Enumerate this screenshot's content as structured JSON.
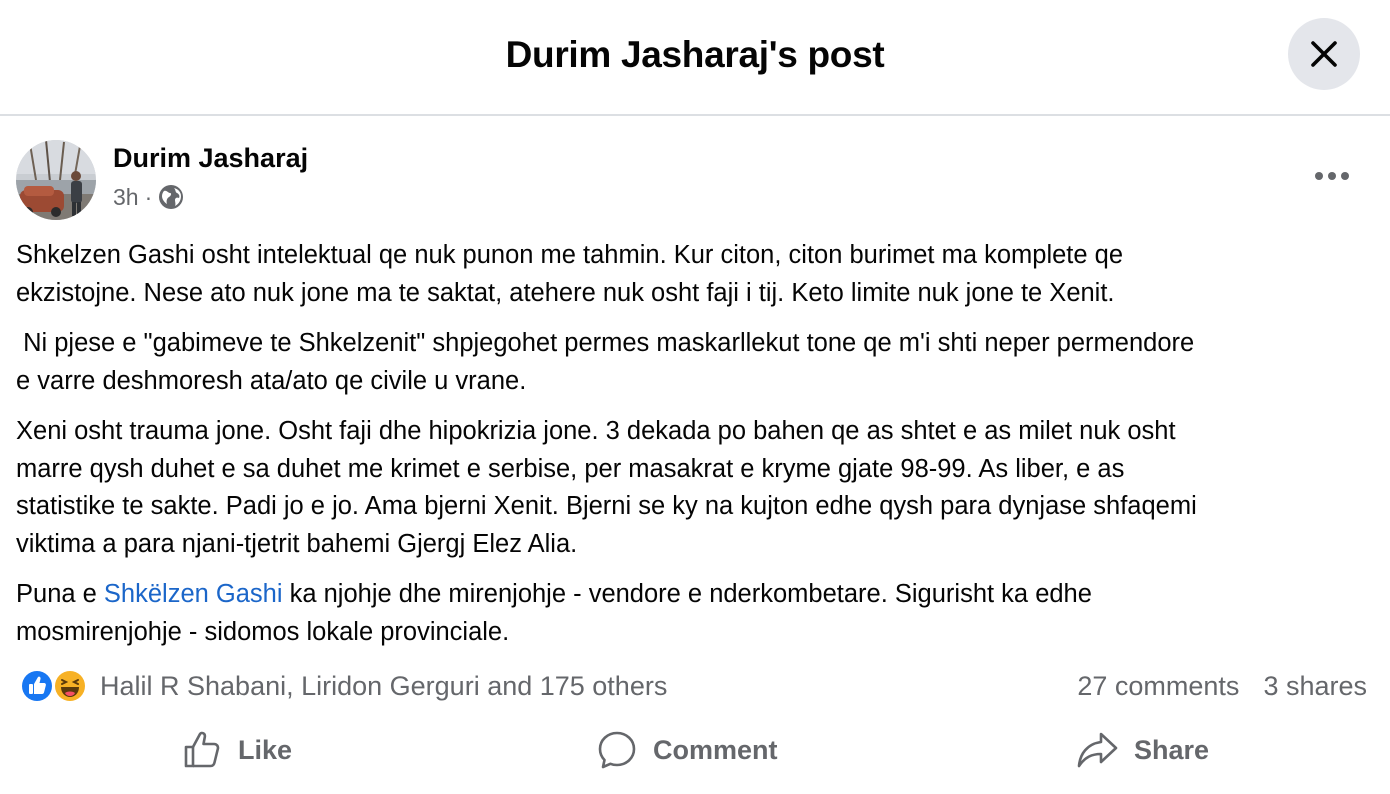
{
  "header": {
    "title": "Durim Jasharaj's post",
    "close_icon": "close-icon"
  },
  "post": {
    "author": "Durim Jasharaj",
    "time": "3h",
    "separator": "·",
    "audience_icon": "globe-icon",
    "more_icon": "more-icon",
    "paragraphs": [
      [
        "Shkelzen Gashi osht intelektual qe nuk punon me tahmin. Kur citon, citon burimet ma komplete qe",
        "ekzistojne. Nese ato nuk jone ma te saktat, atehere nuk osht faji i tij. Keto limite nuk jone te Xenit."
      ],
      [
        " Ni pjese e \"gabimeve te Shkelzenit\" shpjegohet permes maskarllekut tone qe m'i shti neper permendore",
        "e varre deshmoresh ata/ato qe civile u vrane."
      ],
      [
        "Xeni osht trauma jone. Osht faji dhe hipokrizia jone. 3 dekada po bahen qe as shtet e as milet nuk osht",
        "marre qysh duhet e sa duhet me krimet e serbise, per masakrat e kryme gjate 98-99. As liber, e as",
        "statistike te sakte. Padi jo e jo. Ama bjerni Xenit. Bjerni se ky na kujton edhe qysh para dynjase shfaqemi",
        "viktima a para njani-tjetrit bahemi Gjergj Elez Alia."
      ]
    ],
    "last_paragraph": {
      "prefix": "Puna e ",
      "mention": "Shkëlzen Gashi",
      "suffix": " ka njohje dhe mirenjohje - vendore e nderkombetare. Sigurisht ka edhe",
      "line2": "mosmirenjohje - sidomos lokale provinciale."
    }
  },
  "reactions": {
    "icons": [
      "like-reaction-icon",
      "haha-reaction-icon"
    ],
    "summary": "Halil R Shabani, Liridon Gerguri and 175 others",
    "comments": "27 comments",
    "shares": "3 shares"
  },
  "actions": {
    "like": "Like",
    "comment": "Comment",
    "share": "Share"
  },
  "colors": {
    "mention": "#1b66c9",
    "secondary_text": "#65676b",
    "like_blue": "#1877f2",
    "haha_yellow": "#f7b125"
  }
}
